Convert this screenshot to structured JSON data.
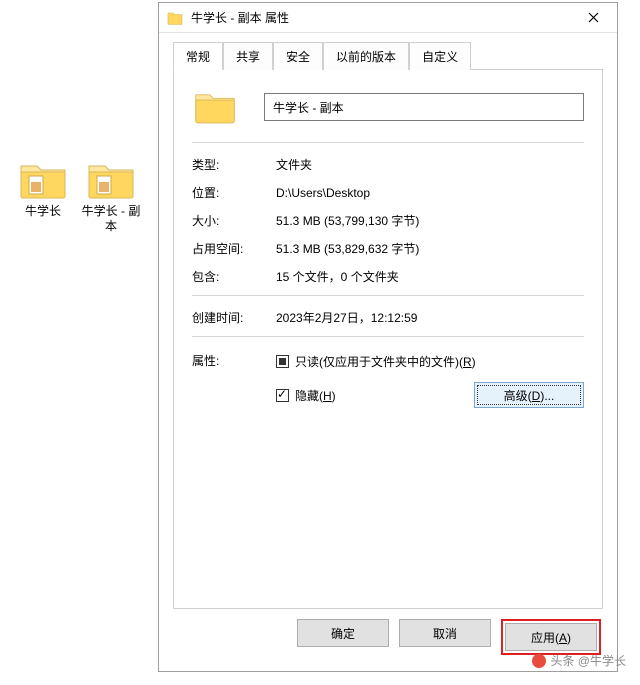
{
  "desktop": {
    "icons": [
      {
        "label": "牛学长"
      },
      {
        "label": "牛学长 - 副本"
      }
    ]
  },
  "dialog": {
    "title": "牛学长 - 副本 属性",
    "tabs": {
      "general": "常规",
      "sharing": "共享",
      "security": "安全",
      "previous": "以前的版本",
      "customize": "自定义"
    },
    "name_value": "牛学长 - 副本",
    "rows": {
      "type_k": "类型:",
      "type_v": "文件夹",
      "location_k": "位置:",
      "location_v": "D:\\Users\\Desktop",
      "size_k": "大小:",
      "size_v": "51.3 MB (53,799,130 字节)",
      "diskSize_k": "占用空间:",
      "diskSize_v": "51.3 MB (53,829,632 字节)",
      "contains_k": "包含:",
      "contains_v": "15 个文件，0 个文件夹",
      "created_k": "创建时间:",
      "created_v": "2023年2月27日，12:12:59",
      "attr_k": "属性:"
    },
    "attrs": {
      "readonly_label_pre": "只读(仅应用于文件夹中的文件)(",
      "readonly_hotkey": "R",
      "readonly_label_post": ")",
      "hidden_label_pre": "隐藏(",
      "hidden_hotkey": "H",
      "hidden_label_post": ")",
      "advanced_label_pre": "高级(",
      "advanced_hotkey": "D",
      "advanced_label_post": ")..."
    },
    "buttons": {
      "ok": "确定",
      "cancel": "取消",
      "apply_pre": "应用(",
      "apply_hotkey": "A",
      "apply_post": ")"
    }
  },
  "watermark": "头条 @牛学长"
}
